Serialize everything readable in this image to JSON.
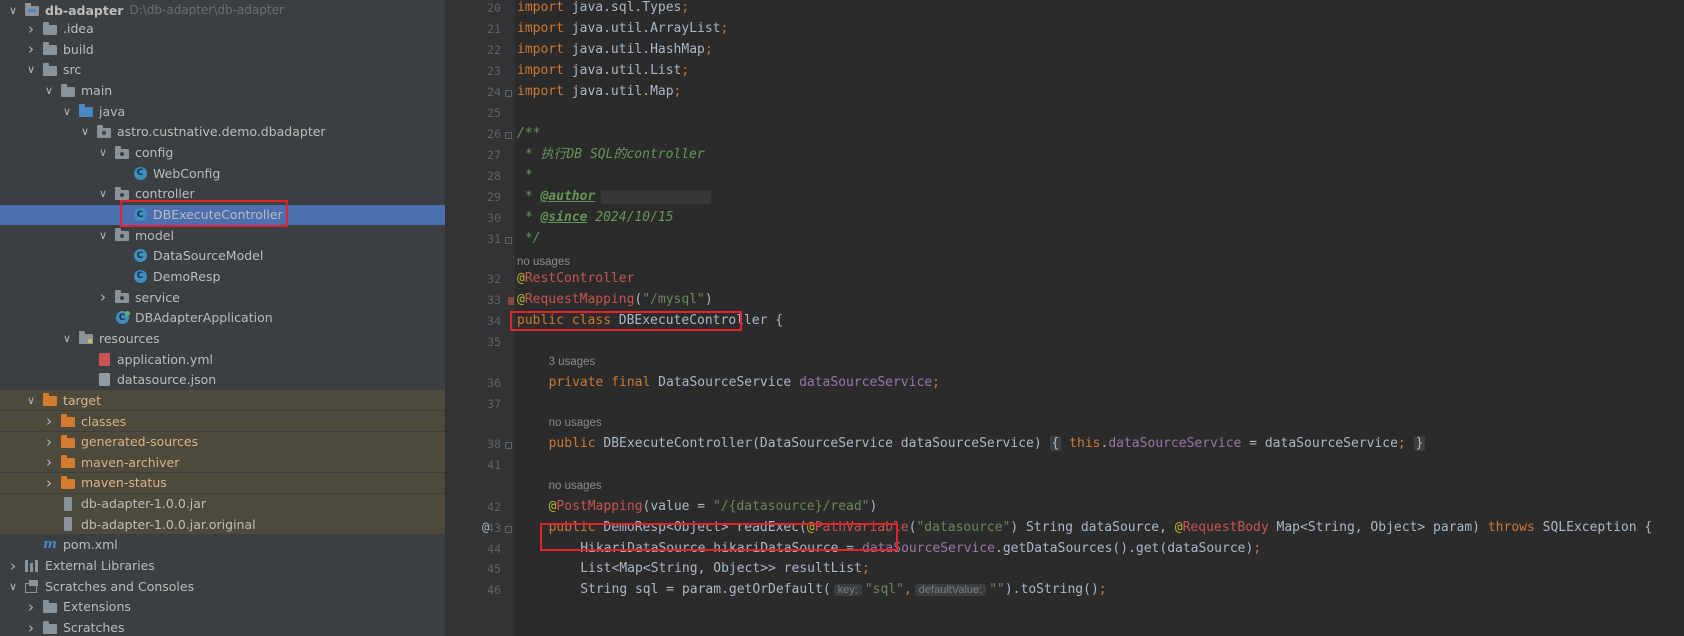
{
  "project": {
    "root_name": "db-adapter",
    "root_path": "D:\\db-adapter\\db-adapter",
    "items": [
      {
        "label": "db-adapter",
        "depth": 0,
        "icon": "module-folder-icon",
        "chevron": "down",
        "bold": true
      },
      {
        "label": ".idea",
        "depth": 1,
        "icon": "folder-icon",
        "chevron": "right"
      },
      {
        "label": "build",
        "depth": 1,
        "icon": "folder-icon",
        "chevron": "right"
      },
      {
        "label": "src",
        "depth": 1,
        "icon": "folder-icon",
        "chevron": "down"
      },
      {
        "label": "main",
        "depth": 2,
        "icon": "folder-icon",
        "chevron": "down"
      },
      {
        "label": "java",
        "depth": 3,
        "icon": "source-folder-icon",
        "chevron": "down"
      },
      {
        "label": "astro.custnative.demo.dbadapter",
        "depth": 4,
        "icon": "package-icon",
        "chevron": "down"
      },
      {
        "label": "config",
        "depth": 5,
        "icon": "package-icon",
        "chevron": "down"
      },
      {
        "label": "WebConfig",
        "depth": 6,
        "icon": "class-icon",
        "chevron": "none"
      },
      {
        "label": "controller",
        "depth": 5,
        "icon": "package-icon",
        "chevron": "down"
      },
      {
        "label": "DBExecuteController",
        "depth": 6,
        "icon": "class-icon",
        "chevron": "none",
        "selected": true
      },
      {
        "label": "model",
        "depth": 5,
        "icon": "package-icon",
        "chevron": "down"
      },
      {
        "label": "DataSourceModel",
        "depth": 6,
        "icon": "class-icon",
        "chevron": "none"
      },
      {
        "label": "DemoResp",
        "depth": 6,
        "icon": "class-icon",
        "chevron": "none"
      },
      {
        "label": "service",
        "depth": 5,
        "icon": "package-icon",
        "chevron": "right"
      },
      {
        "label": "DBAdapterApplication",
        "depth": 5,
        "icon": "spring-app-class-icon",
        "chevron": "none"
      },
      {
        "label": "resources",
        "depth": 3,
        "icon": "resources-folder-icon",
        "chevron": "down"
      },
      {
        "label": "application.yml",
        "depth": 4,
        "icon": "yaml-file-icon",
        "chevron": "none"
      },
      {
        "label": "datasource.json",
        "depth": 4,
        "icon": "json-file-icon",
        "chevron": "none"
      },
      {
        "label": "target",
        "depth": 1,
        "icon": "excluded-folder-icon",
        "chevron": "down",
        "excluded": true
      },
      {
        "label": "classes",
        "depth": 2,
        "icon": "excluded-folder-icon",
        "chevron": "right",
        "excluded": true
      },
      {
        "label": "generated-sources",
        "depth": 2,
        "icon": "excluded-folder-icon",
        "chevron": "right",
        "excluded": true
      },
      {
        "label": "maven-archiver",
        "depth": 2,
        "icon": "excluded-folder-icon",
        "chevron": "right",
        "excluded": true
      },
      {
        "label": "maven-status",
        "depth": 2,
        "icon": "excluded-folder-icon",
        "chevron": "right",
        "excluded": true
      },
      {
        "label": "db-adapter-1.0.0.jar",
        "depth": 2,
        "icon": "jar-file-icon",
        "chevron": "none",
        "excluded": true
      },
      {
        "label": "db-adapter-1.0.0.jar.original",
        "depth": 2,
        "icon": "jar-file-icon",
        "chevron": "none",
        "excluded": true
      },
      {
        "label": "pom.xml",
        "depth": 1,
        "icon": "maven-file-icon",
        "chevron": "none"
      },
      {
        "label": "External Libraries",
        "depth": 0,
        "icon": "libraries-icon",
        "chevron": "right"
      },
      {
        "label": "Scratches and Consoles",
        "depth": 0,
        "icon": "scratches-icon",
        "chevron": "down"
      },
      {
        "label": "Extensions",
        "depth": 1,
        "icon": "folder-icon",
        "chevron": "right"
      },
      {
        "label": "Scratches",
        "depth": 1,
        "icon": "folder-icon",
        "chevron": "right"
      }
    ]
  },
  "editor": {
    "lines": [
      {
        "kind": "code",
        "num": "20",
        "indent": 0,
        "tokens": [
          [
            "kw",
            "import "
          ],
          [
            "",
            "java.sql.Types"
          ],
          [
            "kw",
            ";"
          ]
        ]
      },
      {
        "kind": "code",
        "num": "21",
        "indent": 0,
        "tokens": [
          [
            "kw",
            "import "
          ],
          [
            "",
            "java.util.ArrayList"
          ],
          [
            "kw",
            ";"
          ]
        ]
      },
      {
        "kind": "code",
        "num": "22",
        "indent": 0,
        "tokens": [
          [
            "kw",
            "import "
          ],
          [
            "",
            "java.util.HashMap"
          ],
          [
            "kw",
            ";"
          ]
        ]
      },
      {
        "kind": "code",
        "num": "23",
        "indent": 0,
        "tokens": [
          [
            "kw",
            "import "
          ],
          [
            "",
            "java.util.List"
          ],
          [
            "kw",
            ";"
          ]
        ]
      },
      {
        "kind": "code",
        "num": "24",
        "indent": 0,
        "fold": true,
        "tokens": [
          [
            "kw",
            "import "
          ],
          [
            "",
            "java.util.Map"
          ],
          [
            "kw",
            ";"
          ]
        ]
      },
      {
        "kind": "blank",
        "num": "25"
      },
      {
        "kind": "code",
        "num": "26",
        "indent": 0,
        "fold": true,
        "tokens": [
          [
            "cm",
            "/**"
          ]
        ]
      },
      {
        "kind": "code",
        "num": "27",
        "indent": 0,
        "tokens": [
          [
            "cm",
            " * 执行DB SQL的controller"
          ]
        ]
      },
      {
        "kind": "code",
        "num": "28",
        "indent": 0,
        "tokens": [
          [
            "cm",
            " *"
          ]
        ]
      },
      {
        "kind": "code",
        "num": "29",
        "indent": 0,
        "blur": true,
        "tokens": [
          [
            "cm",
            " * "
          ],
          [
            "tag",
            "@author"
          ]
        ]
      },
      {
        "kind": "code",
        "num": "30",
        "indent": 0,
        "tokens": [
          [
            "cm",
            " * "
          ],
          [
            "tag",
            "@since"
          ],
          [
            "cm",
            " 2024/10/15"
          ]
        ]
      },
      {
        "kind": "code",
        "num": "31",
        "indent": 0,
        "fold": true,
        "tokens": [
          [
            "cm",
            " */"
          ]
        ]
      },
      {
        "kind": "hint",
        "text": "no usages",
        "indent": 0
      },
      {
        "kind": "code",
        "num": "32",
        "indent": 0,
        "tokens": [
          [
            "an",
            "@"
          ],
          [
            "anr",
            "RestController"
          ]
        ]
      },
      {
        "kind": "code",
        "num": "33",
        "indent": 0,
        "bp": true,
        "tokens": [
          [
            "an",
            "@"
          ],
          [
            "anr",
            "RequestMapping"
          ],
          [
            "",
            "("
          ],
          [
            "str",
            "\"/mysql\""
          ],
          [
            "",
            ")"
          ]
        ]
      },
      {
        "kind": "code",
        "num": "34",
        "indent": 0,
        "tokens": [
          [
            "kw",
            "public class "
          ],
          [
            "",
            "DBExecuteController {"
          ]
        ]
      },
      {
        "kind": "blank",
        "num": "35"
      },
      {
        "kind": "hint",
        "text": "3 usages",
        "indent": 4
      },
      {
        "kind": "code",
        "num": "36",
        "indent": 4,
        "tokens": [
          [
            "kw",
            "private final "
          ],
          [
            "",
            "DataSourceService "
          ],
          [
            "fld",
            "dataSourceService"
          ],
          [
            "kw",
            ";"
          ]
        ]
      },
      {
        "kind": "blank",
        "num": "37"
      },
      {
        "kind": "hint",
        "text": "no usages",
        "indent": 4
      },
      {
        "kind": "code",
        "num": "38",
        "indent": 4,
        "fold": true,
        "tokens": [
          [
            "kw",
            "public "
          ],
          [
            "",
            "DBExecuteController(DataSourceService dataSourceService) "
          ],
          [
            "fpill",
            "{"
          ],
          [
            "",
            " "
          ],
          [
            "kw",
            "this"
          ],
          [
            "",
            "."
          ],
          [
            "fld",
            "dataSourceService"
          ],
          [
            "",
            " = dataSourceService"
          ],
          [
            "kw",
            ";"
          ],
          [
            "",
            " "
          ],
          [
            "fpill",
            "}"
          ]
        ]
      },
      {
        "kind": "blank",
        "num": "41"
      },
      {
        "kind": "hint",
        "text": "no usages",
        "indent": 4
      },
      {
        "kind": "code",
        "num": "42",
        "indent": 4,
        "tokens": [
          [
            "an",
            "@"
          ],
          [
            "anr",
            "PostMapping"
          ],
          [
            "",
            "(value = "
          ],
          [
            "str",
            "\"/{datasource}/read\""
          ],
          [
            "",
            ")"
          ]
        ]
      },
      {
        "kind": "code",
        "num": "43",
        "indent": 4,
        "at": true,
        "fold": true,
        "tokens": [
          [
            "kw",
            "public "
          ],
          [
            "",
            "DemoResp<Object> readExec("
          ],
          [
            "an",
            "@"
          ],
          [
            "anr",
            "PathVariable"
          ],
          [
            "",
            "("
          ],
          [
            "str",
            "\"datasource\""
          ],
          [
            "",
            ") String dataSource, "
          ],
          [
            "an",
            "@"
          ],
          [
            "anr",
            "RequestBody"
          ],
          [
            "",
            " Map<String, Object> param) "
          ],
          [
            "kw",
            "throws "
          ],
          [
            "",
            "SQLException {"
          ]
        ]
      },
      {
        "kind": "code",
        "num": "44",
        "indent": 8,
        "tokens": [
          [
            "",
            "HikariDataSource hikariDataSource = "
          ],
          [
            "fld",
            "dataSourceService"
          ],
          [
            "",
            ".getDataSources().get(dataSource)"
          ],
          [
            "kw",
            ";"
          ]
        ]
      },
      {
        "kind": "code",
        "num": "45",
        "indent": 8,
        "tokens": [
          [
            "",
            "List<Map<String, Object>> resultList"
          ],
          [
            "kw",
            ";"
          ]
        ]
      },
      {
        "kind": "code",
        "num": "46",
        "indent": 8,
        "tokens": [
          [
            "",
            "String sql = param.getOrDefault("
          ],
          [
            "inlay",
            "key:"
          ],
          [
            "str",
            "\"sql\""
          ],
          [
            "kw",
            ","
          ],
          [
            "inlay",
            "defaultValue:"
          ],
          [
            "str",
            "\"\""
          ],
          [
            "",
            ").toString()"
          ],
          [
            "kw",
            ";"
          ]
        ]
      }
    ]
  }
}
